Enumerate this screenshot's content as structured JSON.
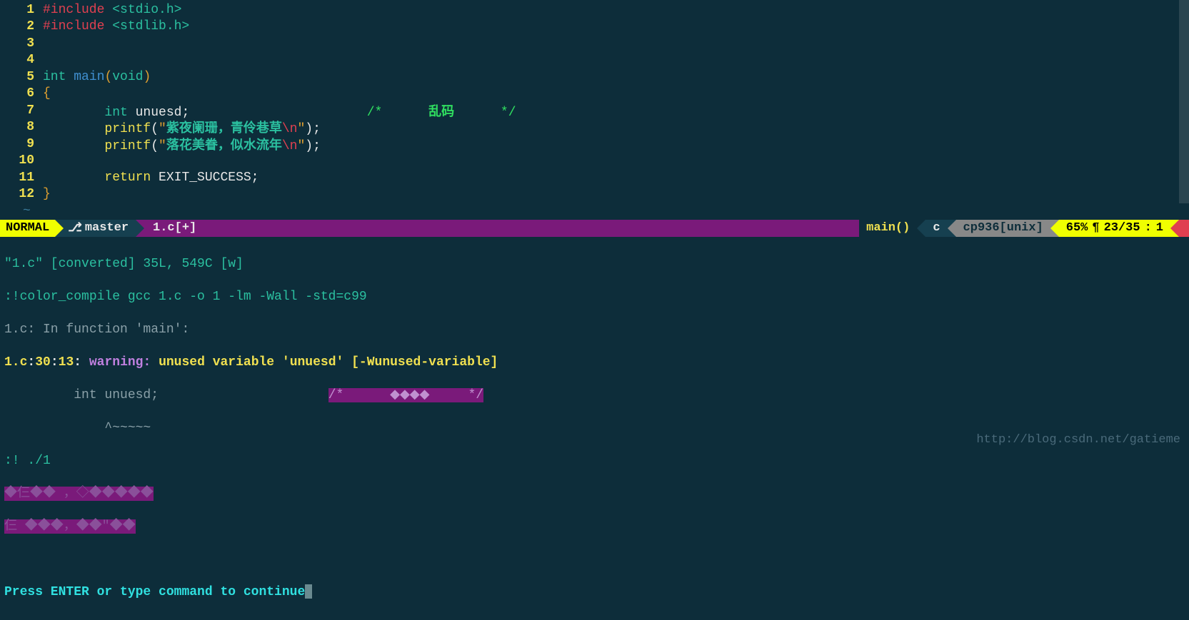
{
  "code": {
    "lines": [
      {
        "n": "1",
        "tokens": [
          [
            "preproc",
            "#include "
          ],
          [
            "incfile",
            "<stdio.h>"
          ]
        ]
      },
      {
        "n": "2",
        "tokens": [
          [
            "preproc",
            "#include "
          ],
          [
            "incfile",
            "<stdlib.h>"
          ]
        ]
      },
      {
        "n": "3",
        "tokens": []
      },
      {
        "n": "4",
        "tokens": []
      },
      {
        "n": "5",
        "tokens": [
          [
            "kw-type",
            "int "
          ],
          [
            "kw-func",
            "main"
          ],
          [
            "brace",
            "("
          ],
          [
            "kw-type",
            "void"
          ],
          [
            "brace",
            ")"
          ]
        ]
      },
      {
        "n": "6",
        "tokens": [
          [
            "brace",
            "{"
          ]
        ]
      },
      {
        "n": "7",
        "tokens": [
          [
            "",
            "        "
          ],
          [
            "kw-type",
            "int"
          ],
          [
            "",
            " unuesd;                       "
          ],
          [
            "comment",
            "/*      "
          ],
          [
            "comment-cn",
            "乱码"
          ],
          [
            "comment",
            "      */"
          ]
        ]
      },
      {
        "n": "8",
        "tokens": [
          [
            "",
            "        "
          ],
          [
            "func",
            "printf"
          ],
          [
            "paren",
            "("
          ],
          [
            "string",
            "\""
          ],
          [
            "string-cn",
            "紫夜阑珊，青伶巷草"
          ],
          [
            "escape",
            "\\n"
          ],
          [
            "string",
            "\""
          ],
          [
            "paren",
            ");"
          ]
        ]
      },
      {
        "n": "9",
        "tokens": [
          [
            "",
            "        "
          ],
          [
            "func",
            "printf"
          ],
          [
            "paren",
            "("
          ],
          [
            "string",
            "\""
          ],
          [
            "string-cn",
            "落花美眷，似水流年"
          ],
          [
            "escape",
            "\\n"
          ],
          [
            "string",
            "\""
          ],
          [
            "paren",
            ");"
          ]
        ]
      },
      {
        "n": "10",
        "tokens": []
      },
      {
        "n": "11",
        "tokens": [
          [
            "",
            "        "
          ],
          [
            "ret",
            "return"
          ],
          [
            "",
            " "
          ],
          [
            "const",
            "EXIT_SUCCESS;"
          ]
        ]
      },
      {
        "n": "12",
        "tokens": [
          [
            "brace",
            "}"
          ]
        ]
      }
    ],
    "tilde": "~"
  },
  "status": {
    "mode": "NORMAL",
    "branch_icon": "⎇",
    "branch": "master",
    "file": "1.c[+]",
    "func": "main()",
    "lang": "c",
    "encoding": "cp936[unix]",
    "percent": "65%",
    "pilcrow": "¶",
    "pos_line": "23/35",
    "pos_sep": ":",
    "pos_col": "1"
  },
  "output": {
    "l1": "\"1.c\" [converted] 35L, 549C [w]",
    "l2": ":!color_compile gcc 1.c -o 1 -lm -Wall -std=c99",
    "l3": "1.c: In function 'main':",
    "l4_file": "1.c",
    "l4_sep1": ":",
    "l4_line": "30",
    "l4_sep2": ":",
    "l4_col": "13",
    "l4_sep3": ": ",
    "l4_warn": "warning: ",
    "l4_msg": "unused variable 'unuesd' [-Wunused-variable]",
    "l5_pre": "         int unuesd;                      ",
    "l5_hl": "/*      ◆◆◆◆     */",
    "l6": "             ^~~~~~",
    "l7": ":! ./1",
    "l8a": "◆仨◆◆ ，◇◆◆◆◆◆",
    "l8b": "仨 ◆◆◆，◆◆\"◆◆",
    "prompt": "Press ENTER or type command to continue"
  },
  "watermark": "http://blog.csdn.net/gatieme"
}
